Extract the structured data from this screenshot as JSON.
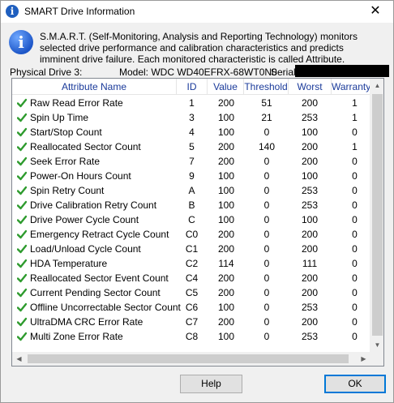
{
  "window": {
    "title": "SMART Drive Information",
    "close_glyph": "✕",
    "title_icon": "info-icon",
    "title_icon_glyph": "i"
  },
  "info": {
    "icon": "info-icon",
    "icon_glyph": "i",
    "description": "S.M.A.R.T. (Self-Monitoring, Analysis and Reporting Technology) monitors selected drive performance and calibration characteristics and predicts imminent drive failure. Each monitored characteristic is called Attribute."
  },
  "drive": {
    "physical_drive": "Physical Drive 3:",
    "model": "Model: WDC WD40EFRX-68WT0N0",
    "serial_label": "Serial:"
  },
  "table": {
    "columns": [
      "Attribute Name",
      "ID",
      "Value",
      "Threshold",
      "Worst",
      "Warranty"
    ],
    "status_icon": "green-check-icon",
    "status_color": "#2e9b2e",
    "rows": [
      {
        "name": "Raw Read Error Rate",
        "id": "1",
        "value": "200",
        "threshold": "51",
        "worst": "200",
        "warranty": "1"
      },
      {
        "name": "Spin Up Time",
        "id": "3",
        "value": "100",
        "threshold": "21",
        "worst": "253",
        "warranty": "1"
      },
      {
        "name": "Start/Stop Count",
        "id": "4",
        "value": "100",
        "threshold": "0",
        "worst": "100",
        "warranty": "0"
      },
      {
        "name": "Reallocated Sector Count",
        "id": "5",
        "value": "200",
        "threshold": "140",
        "worst": "200",
        "warranty": "1"
      },
      {
        "name": "Seek Error Rate",
        "id": "7",
        "value": "200",
        "threshold": "0",
        "worst": "200",
        "warranty": "0"
      },
      {
        "name": "Power-On Hours Count",
        "id": "9",
        "value": "100",
        "threshold": "0",
        "worst": "100",
        "warranty": "0"
      },
      {
        "name": "Spin Retry Count",
        "id": "A",
        "value": "100",
        "threshold": "0",
        "worst": "253",
        "warranty": "0"
      },
      {
        "name": "Drive Calibration Retry Count",
        "id": "B",
        "value": "100",
        "threshold": "0",
        "worst": "253",
        "warranty": "0"
      },
      {
        "name": "Drive Power Cycle Count",
        "id": "C",
        "value": "100",
        "threshold": "0",
        "worst": "100",
        "warranty": "0"
      },
      {
        "name": "Emergency Retract Cycle Count",
        "id": "C0",
        "value": "200",
        "threshold": "0",
        "worst": "200",
        "warranty": "0"
      },
      {
        "name": "Load/Unload Cycle Count",
        "id": "C1",
        "value": "200",
        "threshold": "0",
        "worst": "200",
        "warranty": "0"
      },
      {
        "name": "HDA Temperature",
        "id": "C2",
        "value": "114",
        "threshold": "0",
        "worst": "111",
        "warranty": "0"
      },
      {
        "name": "Reallocated Sector Event Count",
        "id": "C4",
        "value": "200",
        "threshold": "0",
        "worst": "200",
        "warranty": "0"
      },
      {
        "name": "Current Pending Sector Count",
        "id": "C5",
        "value": "200",
        "threshold": "0",
        "worst": "200",
        "warranty": "0"
      },
      {
        "name": "Offline Uncorrectable Sector Count",
        "id": "C6",
        "value": "100",
        "threshold": "0",
        "worst": "253",
        "warranty": "0"
      },
      {
        "name": "UltraDMA CRC Error Rate",
        "id": "C7",
        "value": "200",
        "threshold": "0",
        "worst": "200",
        "warranty": "0"
      },
      {
        "name": "Multi Zone Error Rate",
        "id": "C8",
        "value": "100",
        "threshold": "0",
        "worst": "253",
        "warranty": "0"
      }
    ]
  },
  "buttons": {
    "help": "Help",
    "ok": "OK"
  }
}
